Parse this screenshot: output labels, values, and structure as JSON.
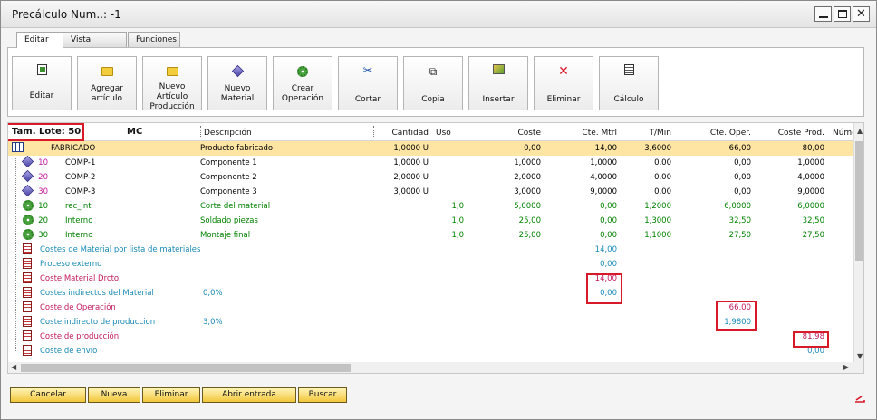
{
  "window": {
    "title": "Precálculo Num..: -1"
  },
  "tabs": [
    {
      "label": "Editar"
    },
    {
      "label": "Vista"
    },
    {
      "label": "Funciones"
    }
  ],
  "toolbar": [
    {
      "label": "Editar",
      "icon": "edit-icon"
    },
    {
      "label": "Agregar artículo",
      "icon": "folder-icon"
    },
    {
      "label": "Nuevo Artículo Producción",
      "icon": "folder-icon"
    },
    {
      "label": "Nuevo Material",
      "icon": "cube-icon"
    },
    {
      "label": "Crear Operación",
      "icon": "gear-icon"
    },
    {
      "label": "Cortar",
      "icon": "scissors-icon"
    },
    {
      "label": "Copia",
      "icon": "copy-icon"
    },
    {
      "label": "Insertar",
      "icon": "paste-icon"
    },
    {
      "label": "Eliminar",
      "icon": "delete-icon"
    },
    {
      "label": "Cálculo",
      "icon": "calculator-icon"
    }
  ],
  "grid": {
    "lot_size": "Tam. Lote: 50",
    "headers": [
      "MC",
      "Descripción",
      "Cantidad",
      "Uso",
      "Coste",
      "Cte. Mtrl",
      "T/Min",
      "Cte. Oper.",
      "Coste Prod.",
      "Núme"
    ],
    "rows": [
      {
        "type": "root",
        "pos": "",
        "code": "FABRICADO",
        "desc": "Producto fabricado",
        "qty": "1,0000 U",
        "uso": "",
        "coste": "0,00",
        "mtrl": "14,00",
        "tmin": "3,6000",
        "oper": "66,00",
        "prod": "80,00",
        "color": "#000000"
      },
      {
        "type": "material",
        "pos": "10",
        "code": "COMP-1",
        "desc": "Componente 1",
        "qty": "1,0000 U",
        "uso": "",
        "coste": "1,0000",
        "mtrl": "1,0000",
        "tmin": "0,00",
        "oper": "0,00",
        "prod": "1,0000",
        "color": "#000000"
      },
      {
        "type": "material",
        "pos": "20",
        "code": "COMP-2",
        "desc": "Componente 2",
        "qty": "2,0000 U",
        "uso": "",
        "coste": "2,0000",
        "mtrl": "4,0000",
        "tmin": "0,00",
        "oper": "0,00",
        "prod": "4,0000",
        "color": "#000000"
      },
      {
        "type": "material",
        "pos": "30",
        "code": "COMP-3",
        "desc": "Componente 3",
        "qty": "3,0000 U",
        "uso": "",
        "coste": "3,0000",
        "mtrl": "9,0000",
        "tmin": "0,00",
        "oper": "0,00",
        "prod": "9,0000",
        "color": "#000000"
      },
      {
        "type": "operation",
        "pos": "10",
        "code": "rec_int",
        "desc": "Corte del material",
        "qty": "",
        "uso": "1,0",
        "coste": "5,0000",
        "mtrl": "0,00",
        "tmin": "1,2000",
        "oper": "6,0000",
        "prod": "6,0000",
        "color": "#008000"
      },
      {
        "type": "operation",
        "pos": "20",
        "code": "Interno",
        "desc": "Soldado piezas",
        "qty": "",
        "uso": "1,0",
        "coste": "25,00",
        "mtrl": "0,00",
        "tmin": "1,3000",
        "oper": "32,50",
        "prod": "32,50",
        "color": "#008000"
      },
      {
        "type": "operation",
        "pos": "30",
        "code": "Interno",
        "desc": "Montaje final",
        "qty": "",
        "uso": "1,0",
        "coste": "25,00",
        "mtrl": "0,00",
        "tmin": "1,1000",
        "oper": "27,50",
        "prod": "27,50",
        "color": "#008000"
      },
      {
        "type": "summary",
        "label": "Costes de Material por lista de materiales",
        "pct": "",
        "mtrl": "14,00",
        "oper": "",
        "prod": "",
        "color": "#1a8ab5"
      },
      {
        "type": "summary",
        "label": "Proceso externo",
        "pct": "",
        "mtrl": "0,00",
        "oper": "",
        "prod": "",
        "color": "#1a8ab5"
      },
      {
        "type": "summary",
        "label": "Coste Material Drcto.",
        "pct": "",
        "mtrl": "14,00",
        "oper": "",
        "prod": "",
        "color": "#c2185b"
      },
      {
        "type": "summary",
        "label": "Costes indirectos del Material",
        "pct": "0,0%",
        "mtrl": "0,00",
        "oper": "",
        "prod": "",
        "color": "#1a8ab5"
      },
      {
        "type": "summary",
        "label": "Coste de Operación",
        "pct": "",
        "mtrl": "",
        "oper": "66,00",
        "prod": "",
        "color": "#c2185b"
      },
      {
        "type": "summary",
        "label": "Coste indirecto de produccion",
        "pct": "3,0%",
        "mtrl": "",
        "oper": "1,9800",
        "prod": "",
        "color": "#1a8ab5"
      },
      {
        "type": "summary",
        "label": "Coste de producción",
        "pct": "",
        "mtrl": "",
        "oper": "",
        "prod": "81,98",
        "color": "#c2185b"
      },
      {
        "type": "summary",
        "label": "Coste de envío",
        "pct": "",
        "mtrl": "",
        "oper": "",
        "prod": "0,00",
        "color": "#1a8ab5"
      }
    ]
  },
  "footer": {
    "buttons": [
      "Cancelar",
      "Nueva",
      "Eliminar",
      "Abrir entrada",
      "Buscar"
    ]
  },
  "colors": {
    "selected_row": "#ffe5a3",
    "highlight_box": "#d7192a",
    "button": "#f2c63b"
  }
}
